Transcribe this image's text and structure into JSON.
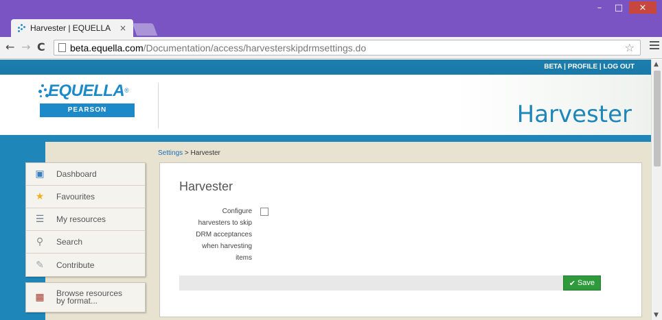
{
  "browser": {
    "tab_title": "Harvester | EQUELLA",
    "tab_close": "×",
    "url_host": "beta.equella.com",
    "url_path": "/Documentation/access/harvesterskipdrmsettings.do",
    "win_minimize": "–",
    "win_maximize": "□",
    "win_close": "×",
    "back": "←",
    "forward": "→",
    "reload": "C",
    "star": "☆"
  },
  "header": {
    "links": [
      "BETA",
      "PROFILE",
      "LOG OUT"
    ],
    "separator": " | ",
    "logo_text": "EQUELLA",
    "logo_mark": "®",
    "logo_sub": "PEARSON",
    "banner_title": "Harvester"
  },
  "breadcrumb": {
    "parent": "Settings",
    "separator": " > ",
    "current": "Harvester"
  },
  "sidebar": {
    "items": [
      {
        "label": "Dashboard",
        "icon": "dashboard-icon",
        "glyph": "▣",
        "color": "#3a7ec2"
      },
      {
        "label": "Favourites",
        "icon": "star-icon",
        "glyph": "★",
        "color": "#f2b01e"
      },
      {
        "label": "My resources",
        "icon": "database-icon",
        "glyph": "☰",
        "color": "#6b7d8c"
      },
      {
        "label": "Search",
        "icon": "search-icon",
        "glyph": "⚲",
        "color": "#888888"
      },
      {
        "label": "Contribute",
        "icon": "contribute-icon",
        "glyph": "✎",
        "color": "#9aa5ad"
      }
    ],
    "browse": {
      "label": "Browse resources by format...",
      "icon": "archive-icon",
      "glyph": "▦",
      "color": "#a23a2e"
    }
  },
  "panel": {
    "title": "Harvester",
    "field_label": "Configure harvesters to skip DRM acceptances when harvesting items",
    "checkbox_checked": false,
    "save_label": "Save",
    "save_icon": "✔"
  },
  "colors": {
    "accent": "#1f86b9",
    "save_green": "#2f9a3b",
    "window_purple": "#7b54c4"
  }
}
